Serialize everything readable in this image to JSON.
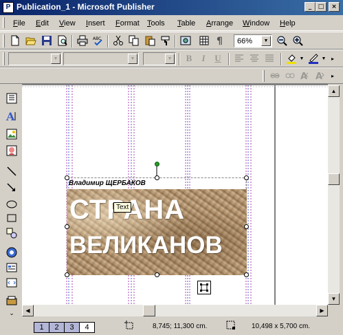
{
  "window": {
    "title": "Publication_1 - Microsoft Publisher",
    "app_icon": "publisher-icon",
    "controls": [
      "minimize",
      "maximize",
      "close"
    ]
  },
  "menubar": {
    "items": [
      "File",
      "Edit",
      "View",
      "Insert",
      "Format",
      "Tools",
      "Table",
      "Arrange",
      "Window",
      "Help"
    ]
  },
  "standard_toolbar": {
    "zoom_value": "66%",
    "icons": [
      "new-icon",
      "open-icon",
      "save-icon",
      "print-preview-icon",
      "print-icon",
      "spelling-icon",
      "cut-icon",
      "copy-icon",
      "paste-icon",
      "format-painter-icon",
      "insert-picture-icon",
      "columns-icon",
      "special-characters-icon",
      "zoom-out-icon",
      "zoom-in-icon"
    ]
  },
  "formatting_toolbar": {
    "style_value": "",
    "font_value": "",
    "size_value": "",
    "bold": "B",
    "italic": "I",
    "underline": "U",
    "fill_color": "#f0e000",
    "line_color": "#2030c0"
  },
  "document": {
    "author_text": "Владимир ЩЕРБАКОВ",
    "headline_line1": "СТРАНА",
    "headline_line2": "ВЕЛИКАНОВ",
    "tooltip": "Text"
  },
  "statusbar": {
    "pages": [
      "1",
      "2",
      "3",
      "4"
    ],
    "active_page": "4",
    "position": "8,745; 11,300 cm.",
    "size": "10,498 x 5,700 cm."
  },
  "colors": {
    "titlebar_start": "#0a246a",
    "titlebar_end": "#3a6ea5",
    "guide_magenta": "#b040b0",
    "guide_blue": "#4060d0"
  }
}
